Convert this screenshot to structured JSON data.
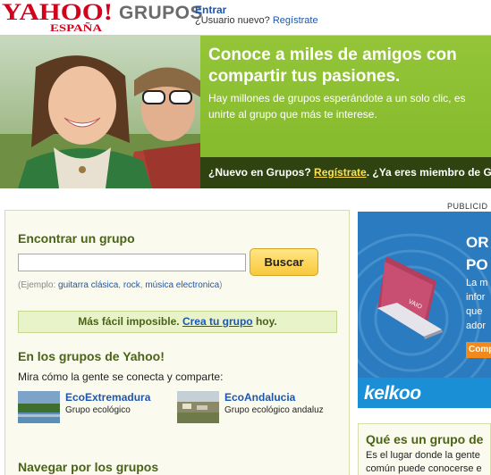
{
  "header": {
    "logo_text": "YAHOO!",
    "logo_sub": "ESPAÑA",
    "product": "GRUPOS",
    "signin_label": "Entrar",
    "new_user_prompt": "¿Usuario nuevo?",
    "register_label": "Regístrate"
  },
  "banner": {
    "headline_1": "Conoce a miles de amigos con",
    "headline_2": "compartir tus pasiones.",
    "sub_1": "Hay millones de grupos esperándote a un solo clic, es",
    "sub_2": "unirte al grupo que más te interese.",
    "cta_prefix": "¿Nuevo en Grupos?",
    "cta_register": "Regístrate",
    "cta_suffix": ". ¿Ya eres miembro de G"
  },
  "advert": {
    "label": "PUBLICID",
    "title_1": "OR",
    "title_2": "PO",
    "body_1": "La m",
    "body_2": "infor",
    "body_3": "que",
    "body_4": "ador",
    "button_label": "Comp",
    "brand": "kelkoo"
  },
  "search": {
    "heading": "Encontrar un grupo",
    "input_value": "",
    "button_label": "Buscar",
    "example_prefix": "(Ejemplo:",
    "example_links": [
      "guitarra clásica",
      "rock",
      "música electronica"
    ],
    "example_suffix": ")"
  },
  "easy": {
    "prefix": "Más fácil imposible.",
    "link": "Crea tu grupo",
    "suffix": "hoy."
  },
  "yahoo_groups": {
    "heading": "En los grupos de Yahoo!",
    "intro": "Mira cómo la gente se conecta y comparte:",
    "items": [
      {
        "name": "EcoExtremadura",
        "desc": "Grupo ecológico"
      },
      {
        "name": "EcoAndalucia",
        "desc": "Grupo ecológico andaluz"
      }
    ]
  },
  "browse": {
    "heading": "Navegar por los grupos"
  },
  "what_is": {
    "title": "Qué es un grupo de",
    "text_1": "Es el lugar donde la gente",
    "text_2": "común puede conocerse e"
  }
}
